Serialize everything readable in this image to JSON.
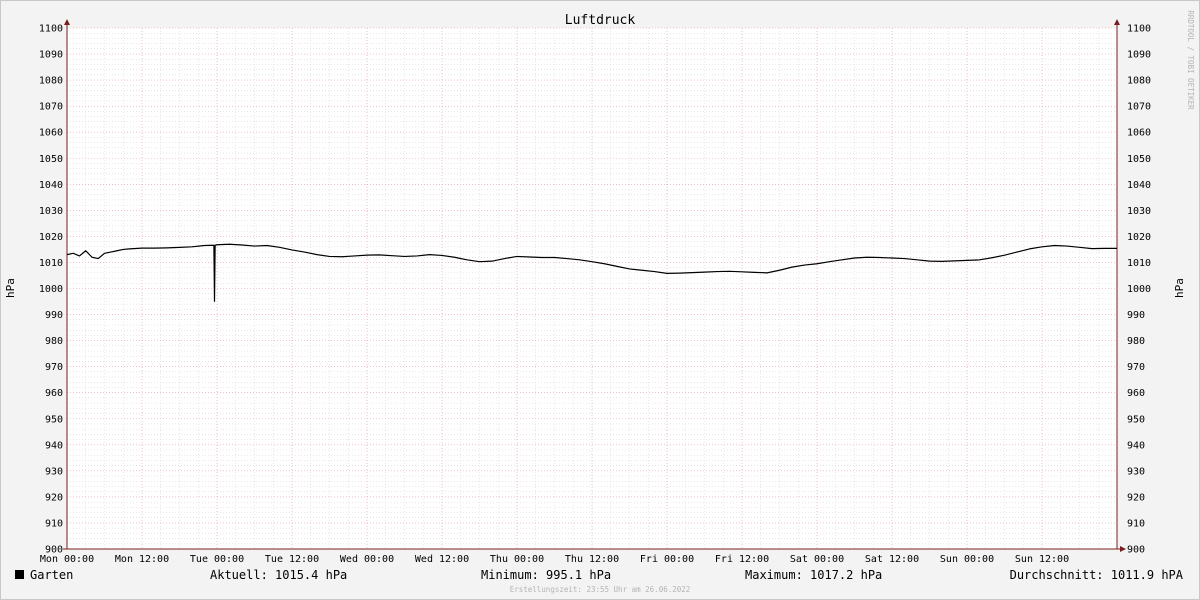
{
  "chart_data": {
    "type": "line",
    "title": "Luftdruck",
    "ylabel": "hPa",
    "ylabel_right": "hPa",
    "ylim": [
      900,
      1100
    ],
    "yticks": [
      900,
      910,
      920,
      930,
      940,
      950,
      960,
      970,
      980,
      990,
      1000,
      1010,
      1020,
      1030,
      1040,
      1050,
      1060,
      1070,
      1080,
      1090,
      1100
    ],
    "xlim_hours": [
      0,
      168
    ],
    "xticks": [
      {
        "h": 0,
        "label": "Mon 00:00"
      },
      {
        "h": 12,
        "label": "Mon 12:00"
      },
      {
        "h": 24,
        "label": "Tue 00:00"
      },
      {
        "h": 36,
        "label": "Tue 12:00"
      },
      {
        "h": 48,
        "label": "Wed 00:00"
      },
      {
        "h": 60,
        "label": "Wed 12:00"
      },
      {
        "h": 72,
        "label": "Thu 00:00"
      },
      {
        "h": 84,
        "label": "Thu 12:00"
      },
      {
        "h": 96,
        "label": "Fri 00:00"
      },
      {
        "h": 108,
        "label": "Fri 12:00"
      },
      {
        "h": 120,
        "label": "Sat 00:00"
      },
      {
        "h": 132,
        "label": "Sat 12:00"
      },
      {
        "h": 144,
        "label": "Sun 00:00"
      },
      {
        "h": 156,
        "label": "Sun 12:00"
      }
    ],
    "grid": true,
    "series": [
      {
        "name": "Garten",
        "color": "#000000",
        "x_hours": [
          0,
          1,
          2,
          3,
          4,
          5,
          6,
          7,
          8,
          9,
          10,
          12,
          14,
          16,
          18,
          20,
          22,
          23.5,
          23.6,
          23.7,
          24,
          26,
          28,
          30,
          32,
          34,
          36,
          38,
          40,
          42,
          44,
          46,
          48,
          50,
          52,
          54,
          56,
          58,
          60,
          62,
          64,
          66,
          68,
          70,
          72,
          74,
          76,
          78,
          80,
          82,
          84,
          86,
          88,
          90,
          92,
          94,
          96,
          98,
          100,
          102,
          104,
          106,
          108,
          110,
          112,
          114,
          116,
          118,
          120,
          122,
          124,
          126,
          128,
          130,
          132,
          134,
          136,
          138,
          140,
          142,
          144,
          146,
          148,
          150,
          152,
          154,
          156,
          158,
          160,
          162,
          164,
          166,
          168
        ],
        "values": [
          1013,
          1013.5,
          1012.5,
          1014.5,
          1012,
          1011.5,
          1013.5,
          1014,
          1014.5,
          1015,
          1015.2,
          1015.5,
          1015.5,
          1015.6,
          1015.8,
          1016,
          1016.5,
          1016.6,
          995.1,
          1016.6,
          1016.8,
          1017,
          1016.7,
          1016.3,
          1016.5,
          1015.8,
          1014.8,
          1014,
          1013,
          1012.3,
          1012.2,
          1012.5,
          1012.8,
          1012.9,
          1012.6,
          1012.3,
          1012.5,
          1013,
          1012.7,
          1012,
          1011,
          1010.3,
          1010.5,
          1011.5,
          1012.3,
          1012.1,
          1011.9,
          1011.9,
          1011.5,
          1011,
          1010.3,
          1009.5,
          1008.5,
          1007.5,
          1007,
          1006.5,
          1005.8,
          1005.9,
          1006.1,
          1006.3,
          1006.5,
          1006.6,
          1006.4,
          1006.2,
          1006,
          1007,
          1008.2,
          1009,
          1009.5,
          1010.3,
          1011,
          1011.7,
          1012,
          1011.9,
          1011.7,
          1011.5,
          1011,
          1010.5,
          1010.4,
          1010.6,
          1010.8,
          1011,
          1011.8,
          1012.8,
          1014,
          1015.2,
          1016,
          1016.5,
          1016.3,
          1015.8,
          1015.3,
          1015.4,
          1015.4
        ]
      }
    ]
  },
  "legend": {
    "series_name": "Garten",
    "aktuell": "Aktuell: 1015.4 hPa",
    "minimum": "Minimum: 995.1 hPa",
    "maximum": "Maximum: 1017.2 hPa",
    "durchschnitt": "Durchschnitt: 1011.9 hPA"
  },
  "footer": "Erstellungszeit: 23:55 Uhr am 26.06.2022",
  "watermark": "RRDTOOL / TOBI OETIKER",
  "colors": {
    "background": "#f3f3f3",
    "plot_background": "#ffffff",
    "major_grid": "#e89aa0",
    "minor_grid": "#d0d0d0",
    "axis": "#7a1f1f",
    "line": "#000000"
  }
}
